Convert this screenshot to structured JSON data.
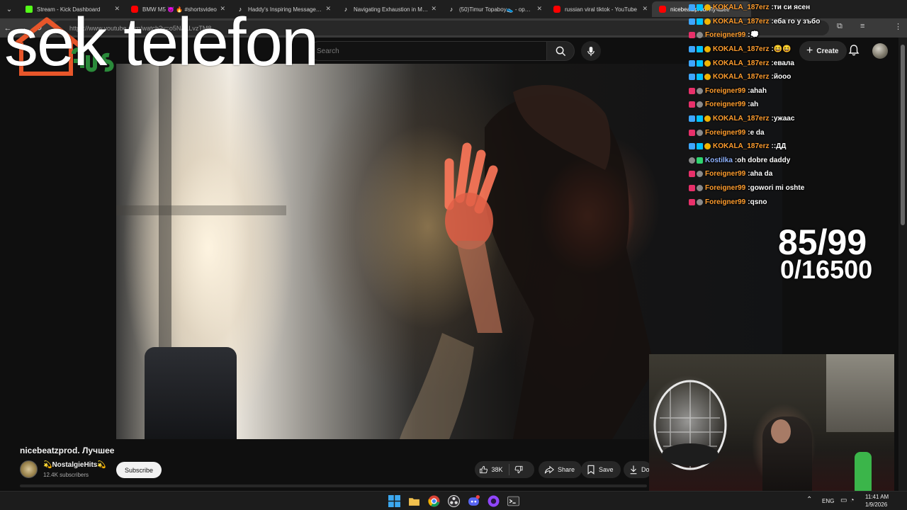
{
  "browser": {
    "tabs": [
      {
        "title": "Stream - Kick Dashboard",
        "favicon": "kick-icon"
      },
      {
        "title": "BMW M5 😈 🔥 #shortsvideo",
        "favicon": "youtube-icon"
      },
      {
        "title": "Haddy's Inspiring Message Afte",
        "favicon": "tiktok-icon"
      },
      {
        "title": "Navigating Exhaustion in Mode",
        "favicon": "tiktok-icon"
      },
      {
        "title": "(50)Timur Topaboy👟 - оригин",
        "favicon": "tiktok-icon"
      },
      {
        "title": "russian viral tiktok - YouTube",
        "favicon": "youtube-icon"
      },
      {
        "title": "nicebeatzprod. Лучшее",
        "favicon": "youtube-icon",
        "active": true
      }
    ],
    "url": "https://www.youtube.com/watch?v=o5NALLvzTM8"
  },
  "youtube": {
    "search_placeholder": "Search",
    "create_label": "Create",
    "video_title": "nicebeatzprod. Лучшее",
    "channel_name": "💫NostalgieHits💫",
    "subscribers": "12.4K subscribers",
    "subscribe_label": "Subscribe",
    "likes": "38K",
    "share_label": "Share",
    "save_label": "Save",
    "download_label": "Do"
  },
  "overlay": {
    "big_text": "sek telefon",
    "counter_main": "85/99",
    "counter_sub": "0/16500"
  },
  "chat": [
    {
      "user": "KOKALA_187erz",
      "badges": [
        "mod",
        "vip",
        "sub"
      ],
      "color": "#ff9d2e",
      "text": "ти си ясен"
    },
    {
      "user": "KOKALA_187erz",
      "badges": [
        "mod",
        "vip",
        "sub"
      ],
      "color": "#ff9d2e",
      "text": "еба го у зъбо"
    },
    {
      "user": "Foreigner99",
      "badges": [
        "gift",
        "og"
      ],
      "color": "#ff9d2e",
      "text": "💭"
    },
    {
      "user": "KOKALA_187erz",
      "badges": [
        "mod",
        "vip",
        "sub"
      ],
      "color": "#ff9d2e",
      "text": "😆😆"
    },
    {
      "user": "KOKALA_187erz",
      "badges": [
        "mod",
        "vip",
        "sub"
      ],
      "color": "#ff9d2e",
      "text": "евала"
    },
    {
      "user": "KOKALA_187erz",
      "badges": [
        "mod",
        "vip",
        "sub"
      ],
      "color": "#ff9d2e",
      "text": "йооо"
    },
    {
      "user": "Foreigner99",
      "badges": [
        "gift",
        "og"
      ],
      "color": "#ff9d2e",
      "text": "ahah"
    },
    {
      "user": "Foreigner99",
      "badges": [
        "gift",
        "og"
      ],
      "color": "#ff9d2e",
      "text": "ah"
    },
    {
      "user": "KOKALA_187erz",
      "badges": [
        "mod",
        "vip",
        "sub"
      ],
      "color": "#ff9d2e",
      "text": "ужаас"
    },
    {
      "user": "Foreigner99",
      "badges": [
        "gift",
        "og"
      ],
      "color": "#ff9d2e",
      "text": "e da"
    },
    {
      "user": "KOKALA_187erz",
      "badges": [
        "mod",
        "vip",
        "sub"
      ],
      "color": "#ff9d2e",
      "text": ":ДД"
    },
    {
      "user": "Kostilka",
      "badges": [
        "og",
        "green"
      ],
      "color": "#8fb3ff",
      "text": "oh dobre daddy"
    },
    {
      "user": "Foreigner99",
      "badges": [
        "gift",
        "og"
      ],
      "color": "#ff9d2e",
      "text": "aha da"
    },
    {
      "user": "Foreigner99",
      "badges": [
        "gift",
        "og"
      ],
      "color": "#ff9d2e",
      "text": "gowori mi oshte"
    },
    {
      "user": "Foreigner99",
      "badges": [
        "gift",
        "og"
      ],
      "color": "#ff9d2e",
      "text": "qsno"
    }
  ],
  "taskbar": {
    "language": "ENG",
    "time": "11:41 AM",
    "date": "1/9/2026"
  },
  "colors": {
    "yt_background": "#0f0f0f",
    "chat_username": "#ff9d2e",
    "subscribe_bg": "#f1f1f1"
  }
}
